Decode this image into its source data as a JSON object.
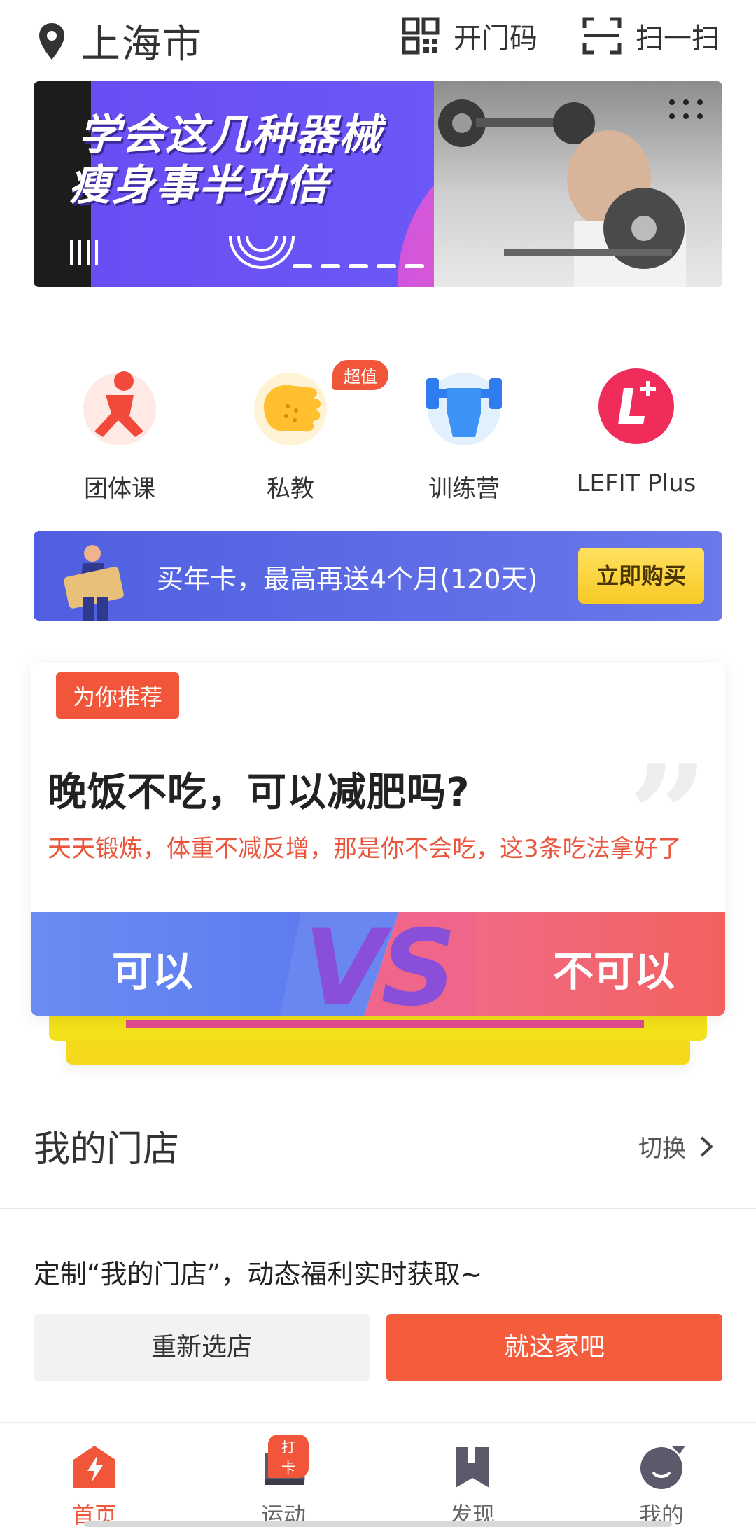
{
  "header": {
    "city": "上海市",
    "door_code_label": "开门码",
    "scan_label": "扫一扫"
  },
  "banner": {
    "line1": "学会这几种器械",
    "line2": "瘦身事半功倍"
  },
  "entries": [
    {
      "label": "团体课",
      "icon": "group-class-icon"
    },
    {
      "label": "私教",
      "icon": "personal-trainer-icon",
      "badge": "超值"
    },
    {
      "label": "训练营",
      "icon": "training-camp-icon"
    },
    {
      "label": "LEFIT Plus",
      "icon": "lefit-plus-icon"
    }
  ],
  "promo": {
    "text": "买年卡，最高再送4个月(120天)",
    "button": "立即购买"
  },
  "recommend": {
    "tag": "为你推荐",
    "question": "晚饭不吃，可以减肥吗?",
    "subtitle": "天天锻炼，体重不减反增，那是你不会吃，这3条吃法拿好了",
    "option_yes": "可以",
    "vs": "VS",
    "option_no": "不可以"
  },
  "store": {
    "title": "我的门店",
    "switch_label": "切换",
    "tip": "定制“我的门店”，动态福利实时获取~",
    "reselect_button": "重新选店",
    "confirm_button": "就这家吧"
  },
  "tabbar": {
    "items": [
      {
        "label": "首页",
        "active": true
      },
      {
        "label": "运动",
        "badge": "打卡"
      },
      {
        "label": "发现"
      },
      {
        "label": "我的"
      }
    ]
  },
  "colors": {
    "accent": "#f2563a",
    "promo_bg": "#5b6ae4",
    "vs_left": "#6a8cf2",
    "vs_right": "#f2615d"
  }
}
